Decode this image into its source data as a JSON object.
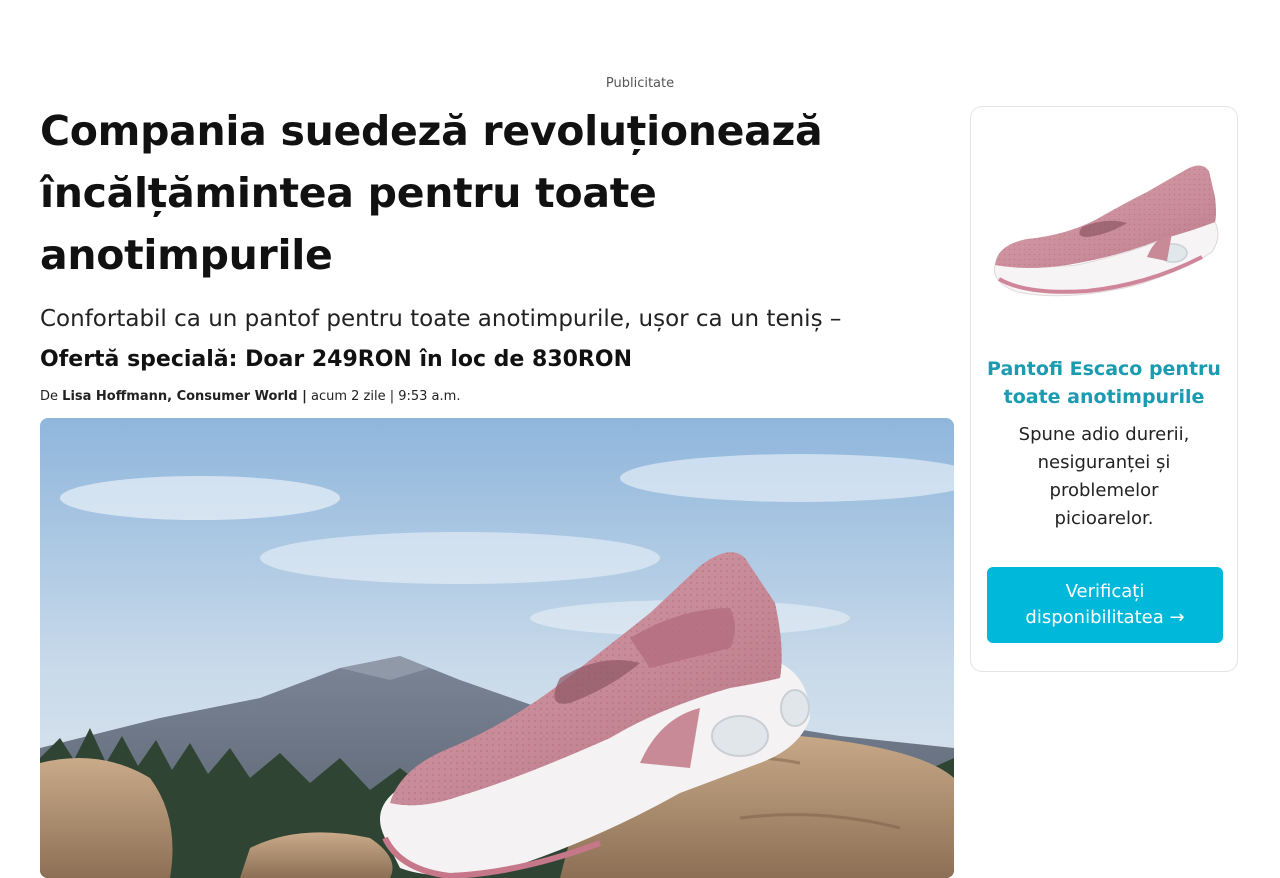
{
  "ad_label": "Publicitate",
  "article": {
    "headline": "Compania suedeză revoluționează încălțămintea pentru toate anotimpurile",
    "subhead": "Confortabil ca un pantof pentru toate anotimpurile, ușor ca un teniș –",
    "offer": "Ofertă specială: Doar 249RON în loc de 830RON",
    "byline": {
      "prefix": "De",
      "author": "Lisa Hoffmann, Consumer World |",
      "time": "acum 2 zile | 9:53 a.m."
    }
  },
  "sidebar": {
    "title": "Pantofi Escaco pentru toate anotimpurile",
    "description": "Spune adio durerii, nesiguranței și problemelor picioarelor.",
    "cta": "Verificați disponibilitatea →"
  },
  "colors": {
    "accent_title": "#1a9bb0",
    "cta_background": "#00b8d9",
    "shoe_pink": "#c98a98"
  }
}
